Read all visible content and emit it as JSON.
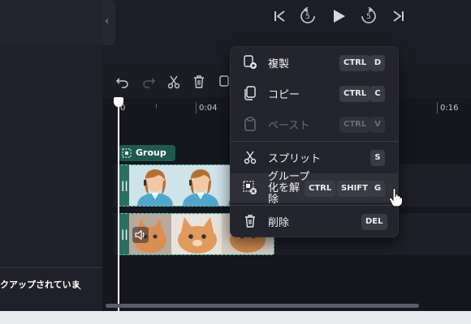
{
  "sidebar": {
    "backup_text": "クアップされていま",
    "collapse_icon": "chevron-left-icon"
  },
  "player": {
    "controls": [
      "skip-back-icon",
      "rewind-5-icon",
      "play-icon",
      "forward-5-icon",
      "skip-forward-icon"
    ],
    "rewind_label": "5",
    "forward_label": "5"
  },
  "timeline": {
    "toolbar_icons": [
      "undo-icon",
      "redo-icon",
      "scissors-icon",
      "trash-icon",
      "duplicate-icon"
    ],
    "ruler": {
      "start": "0",
      "t1": "0:04",
      "t4": "0:16"
    },
    "group_label": "Group 1",
    "clips": [
      {
        "name": "avatar-clip",
        "thumbnail": "avatar-icon"
      },
      {
        "name": "kitten-clip",
        "thumbnail": "kitten-photo",
        "audio_icon": "speaker-icon"
      }
    ]
  },
  "context_menu": {
    "items": [
      {
        "label": "複製",
        "icon": "duplicate-icon",
        "keys": [
          "CTRL",
          "D"
        ],
        "enabled": true
      },
      {
        "label": "コピー",
        "icon": "copy-icon",
        "keys": [
          "CTRL",
          "C"
        ],
        "enabled": true
      },
      {
        "label": "ペースト",
        "icon": "paste-icon",
        "keys": [
          "CTRL",
          "V"
        ],
        "enabled": false
      },
      {
        "label": "スプリット",
        "icon": "scissors-icon",
        "keys": [
          "S"
        ],
        "enabled": true
      },
      {
        "label": "グループ化を解除",
        "label_lines": [
          "グルー",
          "プ",
          "化を解",
          "除"
        ],
        "icon": "ungroup-icon",
        "keys": [
          "CTRL",
          "SHIFT",
          "G"
        ],
        "enabled": true,
        "hovered": true
      },
      {
        "label": "削除",
        "icon": "trash-icon",
        "keys": [
          "DEL"
        ],
        "enabled": true
      }
    ]
  },
  "colors": {
    "background": "#1c1d26",
    "menu_bg": "#23242d",
    "clip_accent": "#2d6e63",
    "clip_border": "#68c8b4"
  }
}
